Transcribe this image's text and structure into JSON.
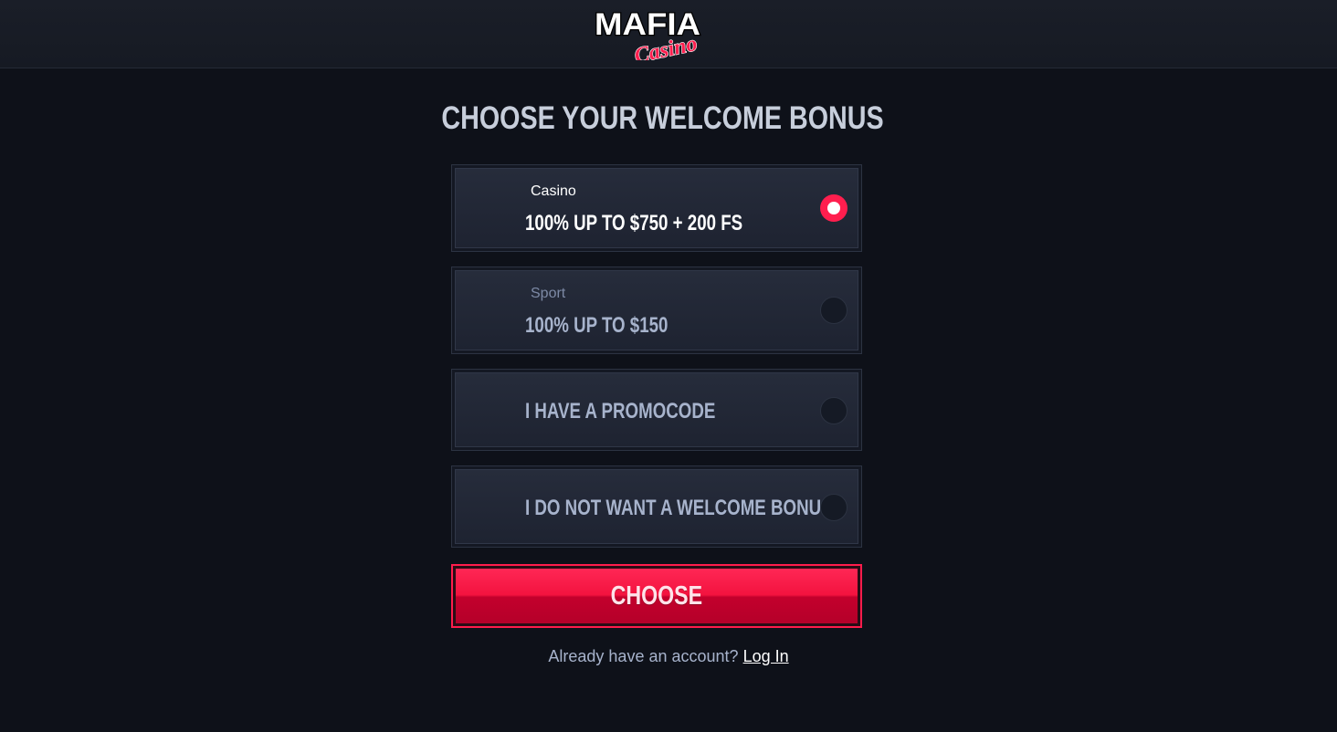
{
  "header": {
    "logo_text_top": "MAFIA",
    "logo_text_script": "Casino"
  },
  "page_title": "CHOOSE YOUR WELCOME BONUS",
  "options": [
    {
      "subtitle": "Casino",
      "label": "100% UP TO $750 + 200 FS",
      "selected": true
    },
    {
      "subtitle": "Sport",
      "label": "100% UP TO $150",
      "selected": false
    },
    {
      "subtitle": "",
      "label": "I HAVE A PROMOCODE",
      "selected": false
    },
    {
      "subtitle": "",
      "label": "I DO NOT WANT A WELCOME BONUS",
      "selected": false
    }
  ],
  "choose_button": "CHOOSE",
  "login": {
    "prompt": "Already have an account?",
    "link": "Log In"
  },
  "colors": {
    "accent": "#ff1e4e",
    "background": "#0e1119"
  }
}
